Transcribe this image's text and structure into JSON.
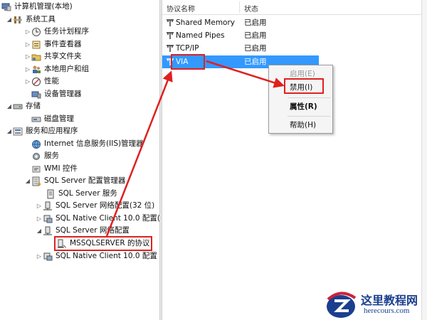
{
  "tree": {
    "root": "计算机管理(本地)",
    "system_tools": "系统工具",
    "task_scheduler": "任务计划程序",
    "event_viewer": "事件查看器",
    "shared_folders": "共享文件夹",
    "local_users": "本地用户和组",
    "performance": "性能",
    "device_manager": "设备管理器",
    "storage": "存储",
    "disk_management": "磁盘管理",
    "services_apps": "服务和应用程序",
    "iis": "Internet 信息服务(IIS)管理器",
    "services": "服务",
    "wmi": "WMI 控件",
    "sql_config": "SQL Server 配置管理器",
    "sql_services": "SQL Server 服务",
    "sql_net32": "SQL Server 网络配置(32 位)",
    "native_client_a": "SQL Native Client 10.0 配置(",
    "sql_net": "SQL Server 网络配置",
    "mssql_protocols": "MSSQLSERVER 的协议",
    "native_client_b": "SQL Native Client 10.0 配置"
  },
  "list": {
    "col_name": "协议名称",
    "col_status": "状态",
    "rows": [
      {
        "name": "Shared Memory",
        "status": "已启用"
      },
      {
        "name": "Named Pipes",
        "status": "已启用"
      },
      {
        "name": "TCP/IP",
        "status": "已启用"
      },
      {
        "name": "VIA",
        "status": "已启用"
      }
    ]
  },
  "context_menu": {
    "enable": "启用(E)",
    "disable": "禁用(I)",
    "properties": "属性(R)",
    "help": "帮助(H)"
  },
  "watermark": {
    "title": "这里教程网",
    "url": "herecours.com"
  },
  "colors": {
    "selection": "#3399ff",
    "annotation_red": "#e02020",
    "watermark_blue": "#1b3f8f"
  }
}
